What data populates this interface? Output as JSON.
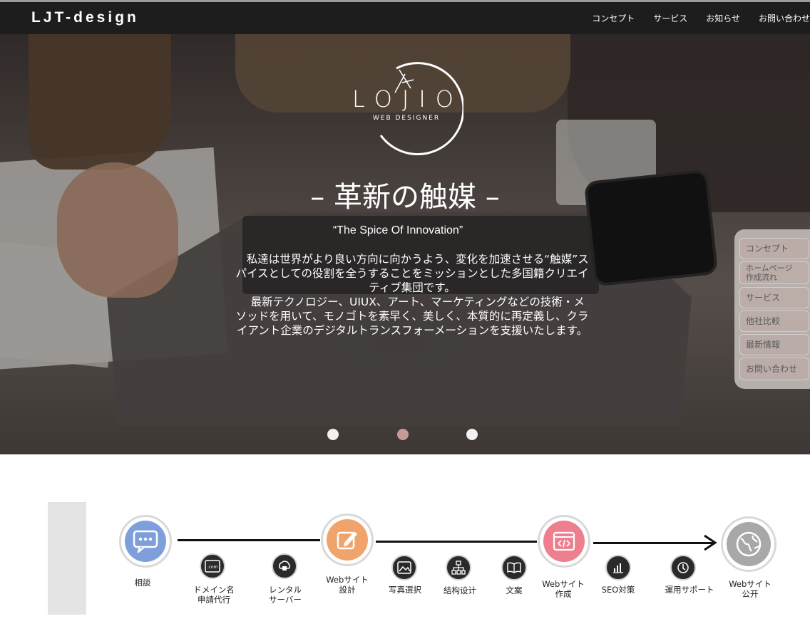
{
  "header": {
    "brand": "LJT-design",
    "nav": [
      "コンセプト",
      "サービス",
      "お知らせ",
      "お問い合わせ"
    ]
  },
  "hero": {
    "logo_text": "LOJIO",
    "logo_sub": "WEB DESIGNER",
    "catch": "– 革新の触媒 –",
    "subcatch": "“The Spice Of Innovation”",
    "desc_lines": [
      "　私達は世界がより良い方向に向かうよう、変化を加速させる“触媒”スパイスとしての役割を全うすることをミッションとした多国籍クリエイティブ集団です。",
      "　最新テクノロジー、UIUX、アート、マーケティングなどの技術・メソッドを用いて、モノゴトを素早く、美しく、本質的に再定義し、クライアント企業のデジタルトランスフォーメーションを支援いたします。"
    ],
    "slider": {
      "count": 3,
      "active_index": 1
    }
  },
  "side_menu": [
    "コンセプト",
    "ホームページ\n作成流れ",
    "サービス",
    "他社比較",
    "最新情報",
    "お問い合わせ"
  ],
  "flow": {
    "steps": [
      {
        "label": "相談",
        "icon": "chat-bubble-icon",
        "color": "#7f9fdc",
        "major": true
      },
      {
        "label": "ドメイン名\n申請代行",
        "icon": "domain-icon",
        "major": false
      },
      {
        "label": "レンタル\nサーバー",
        "icon": "server-icon",
        "major": false
      },
      {
        "label": "Webサイト\n設計",
        "icon": "pencil-edit-icon",
        "color": "#f0a36a",
        "major": true
      },
      {
        "label": "写真選択",
        "icon": "image-icon",
        "major": false
      },
      {
        "label": "結构设计",
        "icon": "sitemap-icon",
        "major": false
      },
      {
        "label": "文案",
        "icon": "book-icon",
        "major": false
      },
      {
        "label": "Webサイト\n作成",
        "icon": "code-window-icon",
        "color": "#ee7f8e",
        "major": true
      },
      {
        "label": "SEO対策",
        "icon": "chart-icon",
        "major": false
      },
      {
        "label": "運用サポート",
        "icon": "support-icon",
        "major": false
      },
      {
        "label": "Webサイト\n公开",
        "icon": "globe-icon",
        "color": "#a8a8a8",
        "major": true
      }
    ]
  }
}
